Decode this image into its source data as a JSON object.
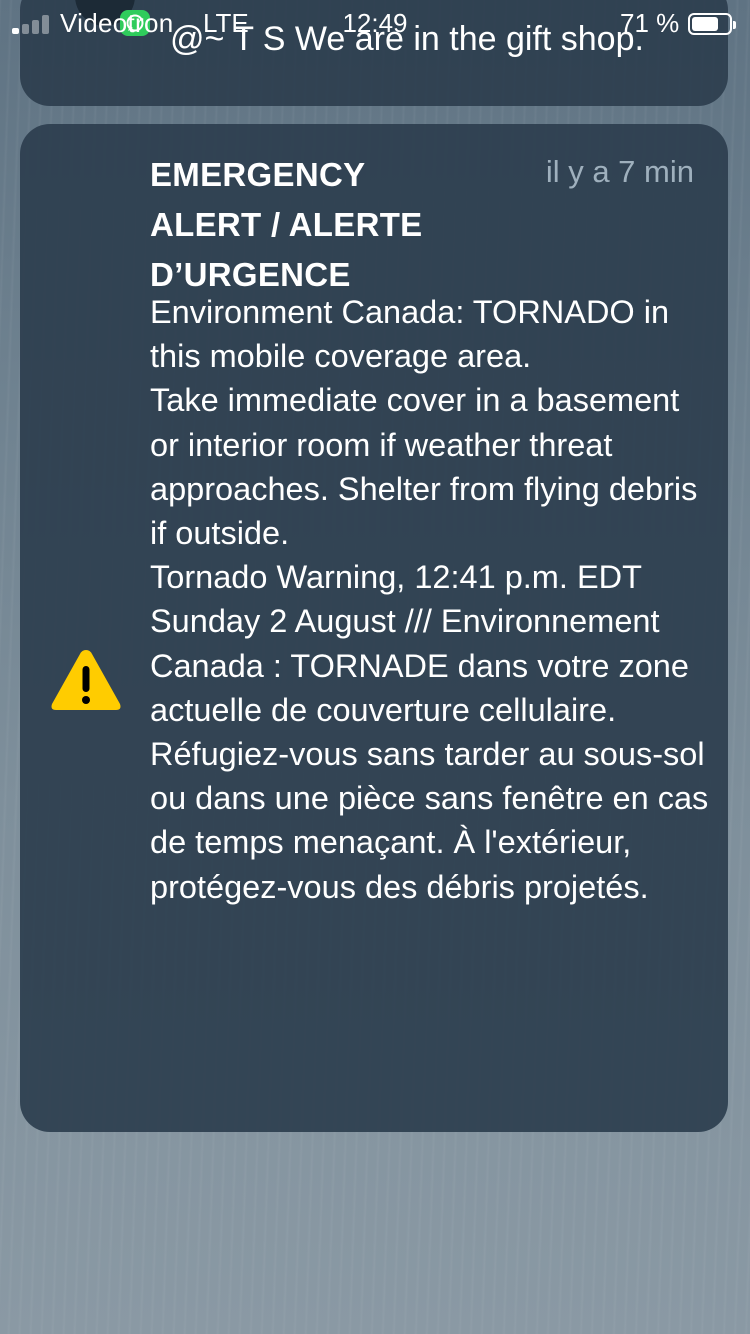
{
  "status_bar": {
    "carrier": "Videotron",
    "network": "LTE",
    "time": "12:49",
    "battery_percent": "71 %",
    "battery_level": 0.71,
    "signal_bars_active": 1,
    "signal_bars_total": 4
  },
  "notifications": [
    {
      "app_icon": "whatsapp-icon",
      "text": "@~ T S We are in the gift shop."
    },
    {
      "icon": "warning-triangle-icon",
      "title": "EMERGENCY ALERT / ALERTE D’URGENCE",
      "time": "il y a 7 min",
      "body": [
        "Environment Canada: TORNADO in this mobile coverage area.",
        "Take immediate cover in a basement or interior room if weather threat approaches. Shelter from flying debris if outside.",
        "Tornado Warning, 12:41 p.m. EDT Sunday 2 August /// Environnement Canada : TORNADE dans votre zone actuelle de couverture cellulaire. Réfugiez-vous sans tarder au sous-sol ou dans une pièce sans fenêtre en cas de temps menaçant. À l'extérieur, protégez-vous des débris projetés."
      ]
    }
  ],
  "colors": {
    "card_bg": "#2c3e4e",
    "warning_yellow": "#ffcc00",
    "whatsapp_green": "#2fcc5c",
    "timestamp": "#9fb0bd"
  }
}
